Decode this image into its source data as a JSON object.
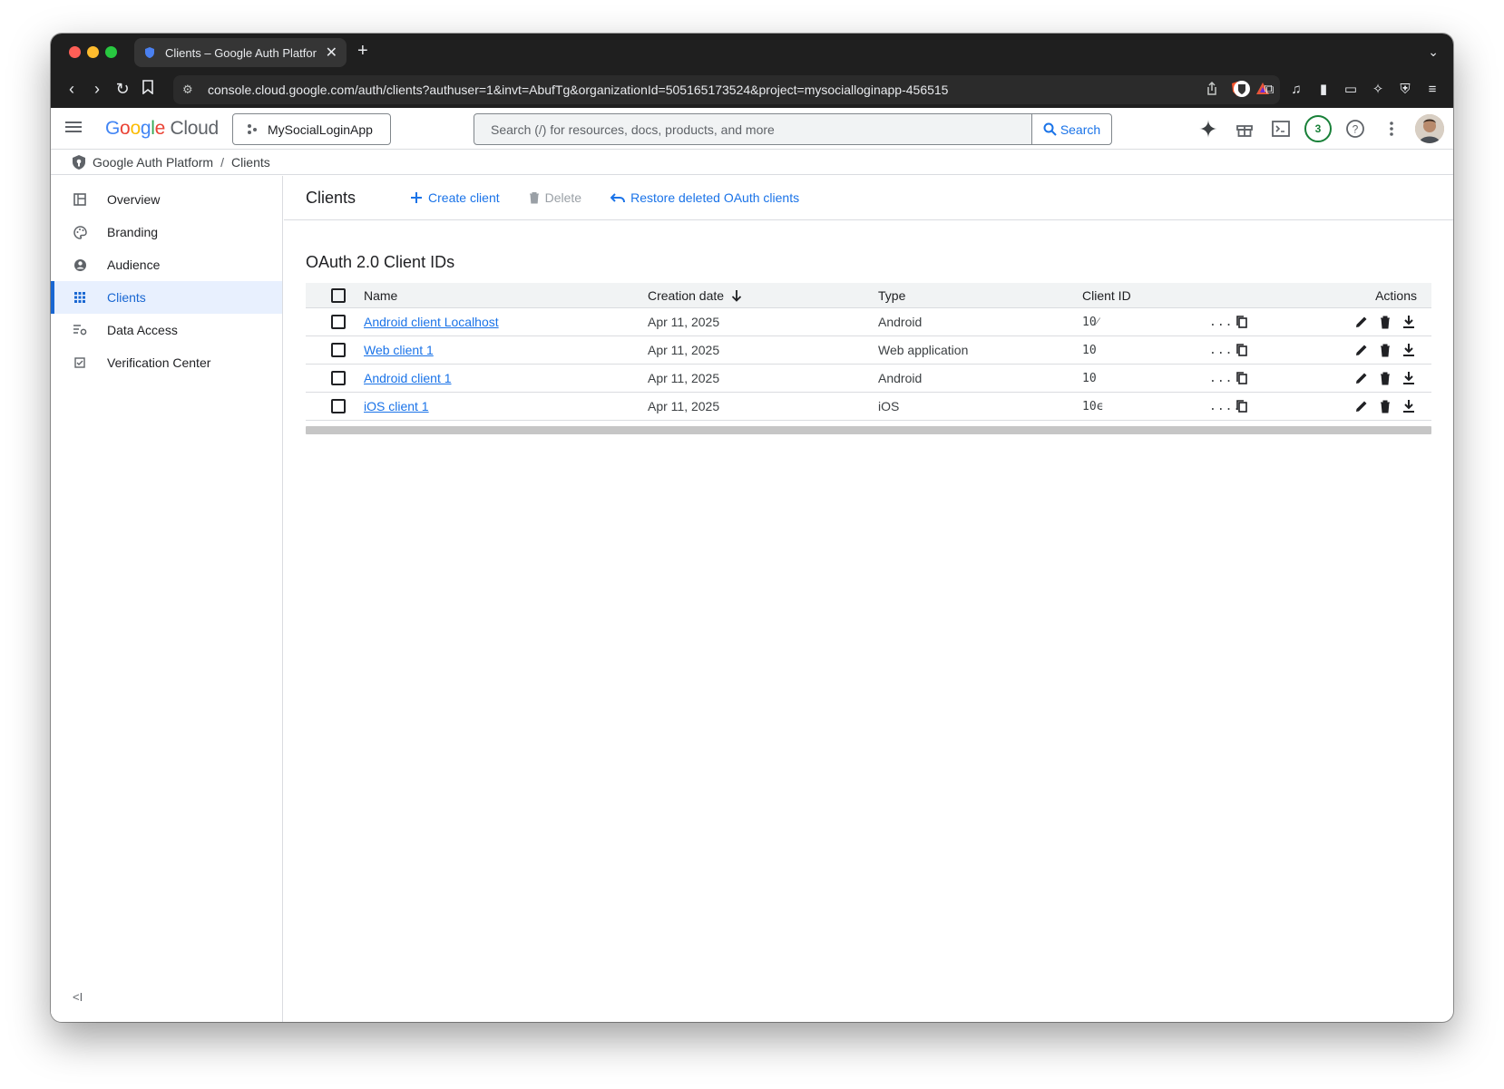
{
  "browser": {
    "tab_title": "Clients – Google Auth Platfor",
    "url": "console.cloud.google.com/auth/clients?authuser=1&invt=AbufTg&organizationId=505165173524&project=mysocialloginapp-456515"
  },
  "header": {
    "logo_google": [
      "G",
      "o",
      "o",
      "g",
      "l",
      "e"
    ],
    "logo_cloud": "Cloud",
    "project": "MySocialLoginApp",
    "search_placeholder": "Search (/) for resources, docs, products, and more",
    "search_button": "Search",
    "notification_count": "3"
  },
  "breadcrumb": {
    "root": "Google Auth Platform",
    "separator": "/",
    "current": "Clients"
  },
  "sidebar": {
    "items": [
      {
        "label": "Overview",
        "icon": "dashboard-icon"
      },
      {
        "label": "Branding",
        "icon": "palette-icon"
      },
      {
        "label": "Audience",
        "icon": "account-circle-icon"
      },
      {
        "label": "Clients",
        "icon": "grid-icon"
      },
      {
        "label": "Data Access",
        "icon": "data-settings-icon"
      },
      {
        "label": "Verification Center",
        "icon": "check-box-icon"
      }
    ],
    "collapse": "<I"
  },
  "toolbar": {
    "title": "Clients",
    "create": "Create client",
    "delete": "Delete",
    "restore": "Restore deleted OAuth clients"
  },
  "section_title": "OAuth 2.0 Client IDs",
  "table": {
    "headers": {
      "name": "Name",
      "date": "Creation date",
      "type": "Type",
      "client_id": "Client ID",
      "actions": "Actions"
    },
    "rows": [
      {
        "name": "Android client Localhost",
        "date": "Apr 11, 2025",
        "type": "Android",
        "id_prefix": "10⁄",
        "id_suffix": "..."
      },
      {
        "name": "Web client 1",
        "date": "Apr 11, 2025",
        "type": "Web application",
        "id_prefix": "10",
        "id_suffix": "..."
      },
      {
        "name": "Android client 1",
        "date": "Apr 11, 2025",
        "type": "Android",
        "id_prefix": "10",
        "id_suffix": "..."
      },
      {
        "name": "iOS client 1",
        "date": "Apr 11, 2025",
        "type": "iOS",
        "id_prefix": "10ϵ",
        "id_suffix": "...."
      }
    ]
  },
  "colors": {
    "accent": "#1a73e8",
    "active_bg": "#e8f0fe",
    "border": "#dadce0"
  }
}
